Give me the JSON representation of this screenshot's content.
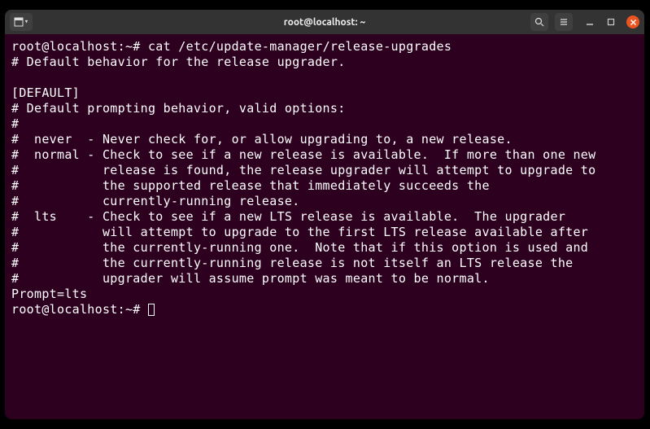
{
  "titlebar": {
    "title": "root@localhost: ~"
  },
  "terminal": {
    "prompt1": "root@localhost:~#",
    "command1": " cat /etc/update-manager/release-upgrades",
    "lines": [
      "# Default behavior for the release upgrader.",
      "",
      "[DEFAULT]",
      "# Default prompting behavior, valid options:",
      "#",
      "#  never  - Never check for, or allow upgrading to, a new release.",
      "#  normal - Check to see if a new release is available.  If more than one new",
      "#           release is found, the release upgrader will attempt to upgrade to",
      "#           the supported release that immediately succeeds the",
      "#           currently-running release.",
      "#  lts    - Check to see if a new LTS release is available.  The upgrader",
      "#           will attempt to upgrade to the first LTS release available after",
      "#           the currently-running one.  Note that if this option is used and",
      "#           the currently-running release is not itself an LTS release the",
      "#           upgrader will assume prompt was meant to be normal.",
      "Prompt=lts"
    ],
    "prompt2": "root@localhost:~#",
    "command2": " "
  }
}
